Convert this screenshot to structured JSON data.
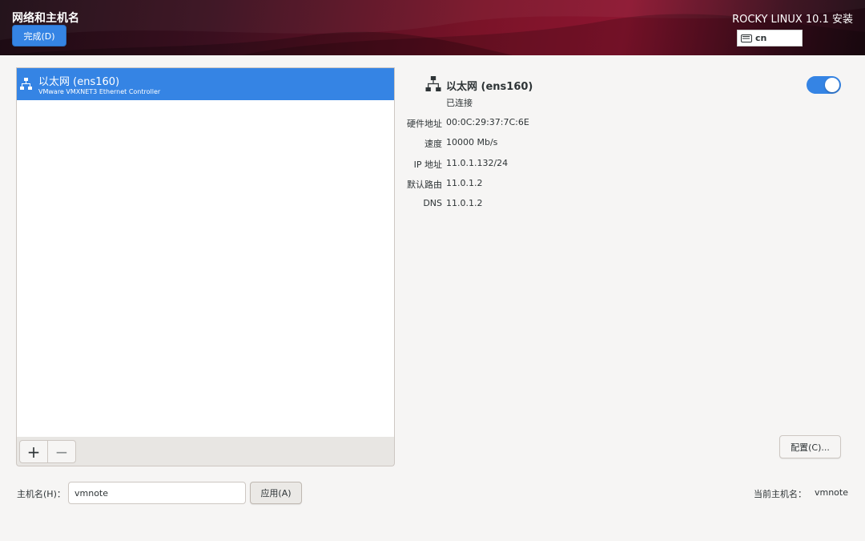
{
  "header": {
    "title": "网络和主机名",
    "done_label": "完成(D)",
    "product": "ROCKY LINUX 10.1 安装",
    "keyboard_layout": "cn"
  },
  "devices": [
    {
      "name": "以太网 (ens160)",
      "description": "VMware VMXNET3 Ethernet Controller",
      "selected": true
    }
  ],
  "device_toolbar": {
    "add_label": "+",
    "remove_label": "−"
  },
  "details": {
    "name": "以太网 (ens160)",
    "status": "已连接",
    "enabled": true,
    "fields": [
      {
        "label": "硬件地址",
        "value": "00:0C:29:37:7C:6E"
      },
      {
        "label": "速度",
        "value": "10000 Mb/s"
      },
      {
        "label": "IP 地址",
        "value": "11.0.1.132/24"
      },
      {
        "label": "默认路由",
        "value": "11.0.1.2"
      },
      {
        "label": "DNS",
        "value": "11.0.1.2"
      }
    ],
    "configure_label": "配置(C)..."
  },
  "hostname": {
    "label": "主机名(H)：",
    "value": "vmnote",
    "apply_label": "应用(A)",
    "current_label": "当前主机名：",
    "current_value": "vmnote"
  },
  "colors": {
    "accent": "#3584e4",
    "header_red": "#8d1530",
    "background": "#f6f5f4"
  },
  "icons": {
    "network": "network-wired-icon",
    "keyboard": "keyboard-icon"
  }
}
